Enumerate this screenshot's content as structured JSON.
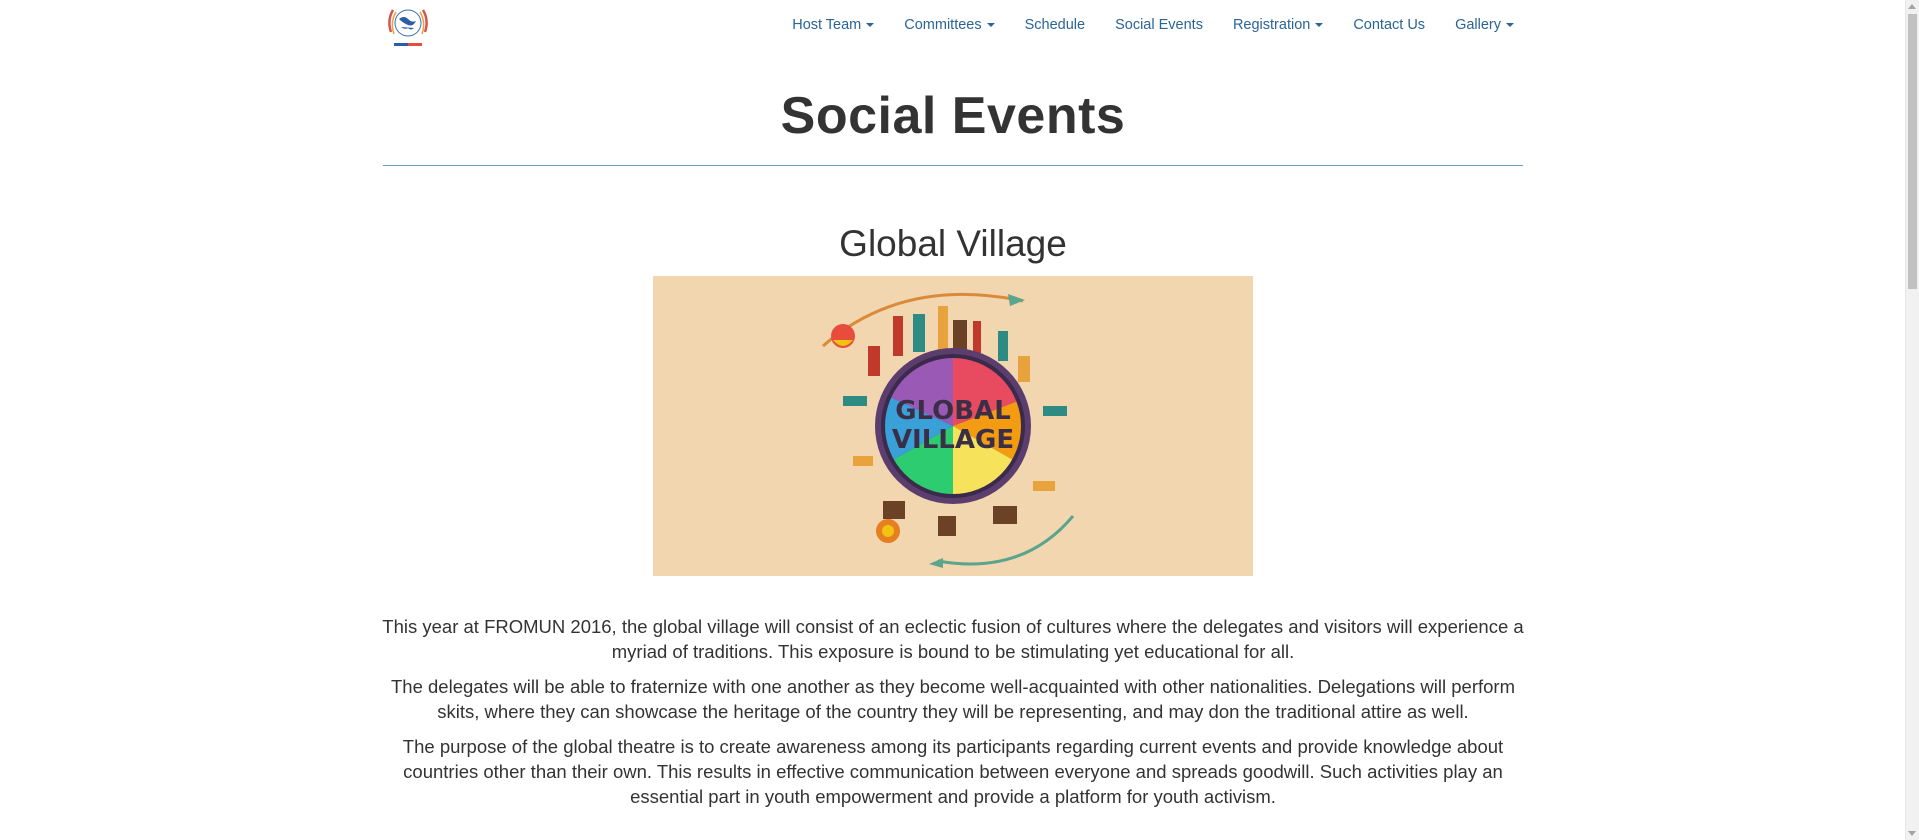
{
  "nav": {
    "items": [
      {
        "label": "Host Team",
        "dropdown": true
      },
      {
        "label": "Committees",
        "dropdown": true
      },
      {
        "label": "Schedule",
        "dropdown": false
      },
      {
        "label": "Social Events",
        "dropdown": false
      },
      {
        "label": "Registration",
        "dropdown": true
      },
      {
        "label": "Contact Us",
        "dropdown": false
      },
      {
        "label": "Gallery",
        "dropdown": true
      }
    ],
    "link_color": "#2a6496"
  },
  "page": {
    "title": "Social Events",
    "rule_color": "#6a9fbd"
  },
  "section": {
    "title": "Global Village",
    "image_text_line1": "GLOBAL",
    "image_text_line2": "VILLAGE",
    "image_bg": "#f2d6b0"
  },
  "paragraphs": [
    "This year at FROMUN 2016, the global village will consist of an eclectic fusion of cultures where the delegates and visitors will experience a myriad of traditions. This exposure is bound to be stimulating yet educational for all.",
    "The delegates will be able to fraternize with one another as they become well-acquainted with other nationalities. Delegations will perform skits, where they can showcase the heritage of the country they will be representing, and may don the traditional attire as well.",
    "The purpose of the global theatre is to create awareness among its participants regarding current events and provide knowledge about countries other than their own. This results in effective communication between everyone and spreads goodwill. Such activities play an essential part in youth empowerment and provide a platform for youth activism."
  ]
}
